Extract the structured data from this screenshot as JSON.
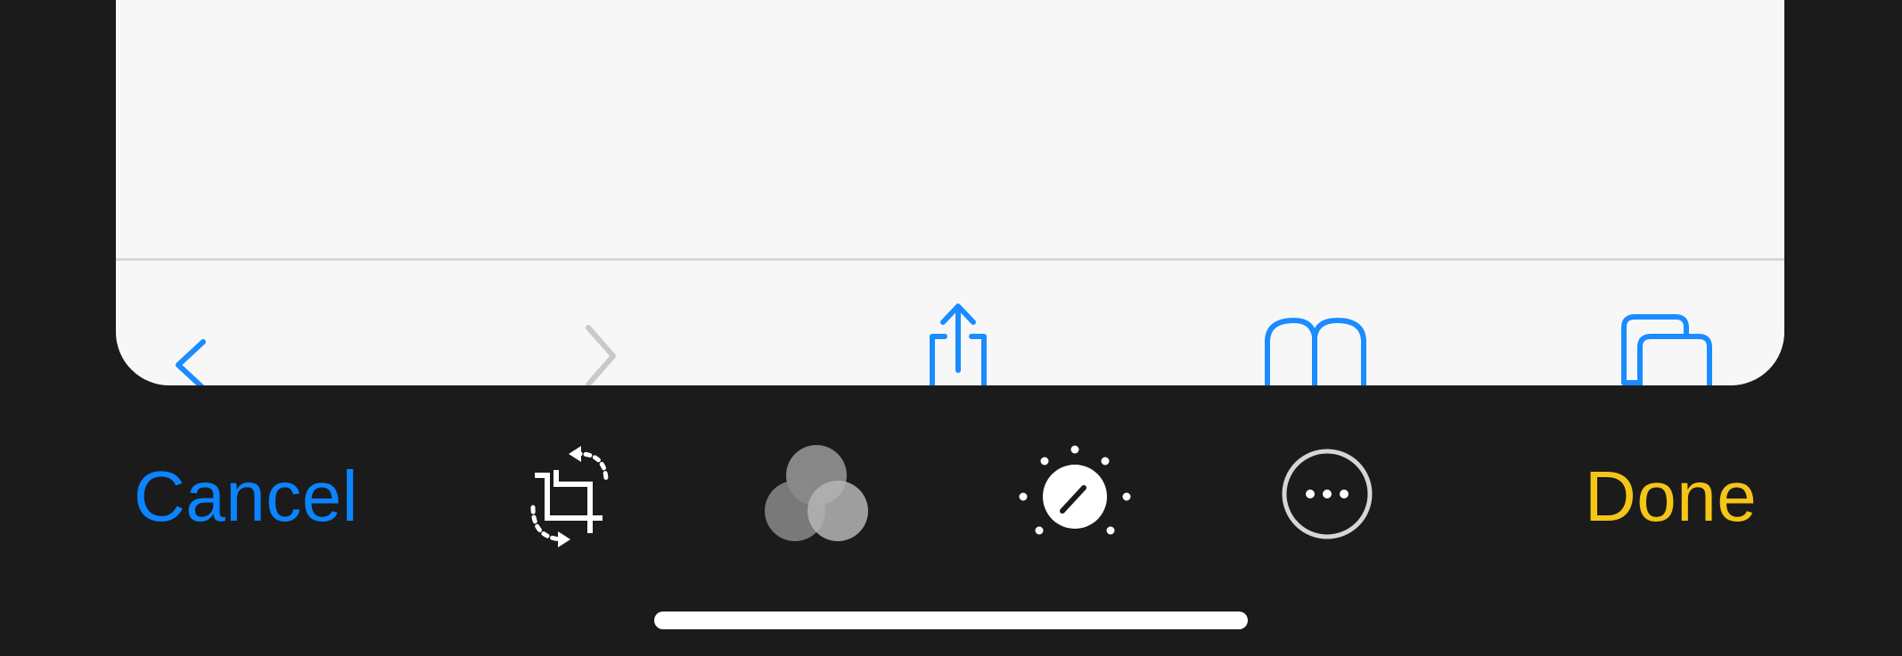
{
  "editor": {
    "cancel_label": "Cancel",
    "done_label": "Done",
    "accent_cancel": "#0a84ff",
    "accent_done": "#f5c518"
  },
  "tools": [
    {
      "name": "crop-rotate-icon"
    },
    {
      "name": "filters-icon"
    },
    {
      "name": "adjust-icon"
    },
    {
      "name": "more-icon"
    }
  ],
  "preview": {
    "toolbar_icons": [
      "back-chevron-icon",
      "forward-chevron-icon",
      "share-icon",
      "bookmarks-icon",
      "tabs-icon"
    ],
    "icon_color": "#1a8cff"
  }
}
